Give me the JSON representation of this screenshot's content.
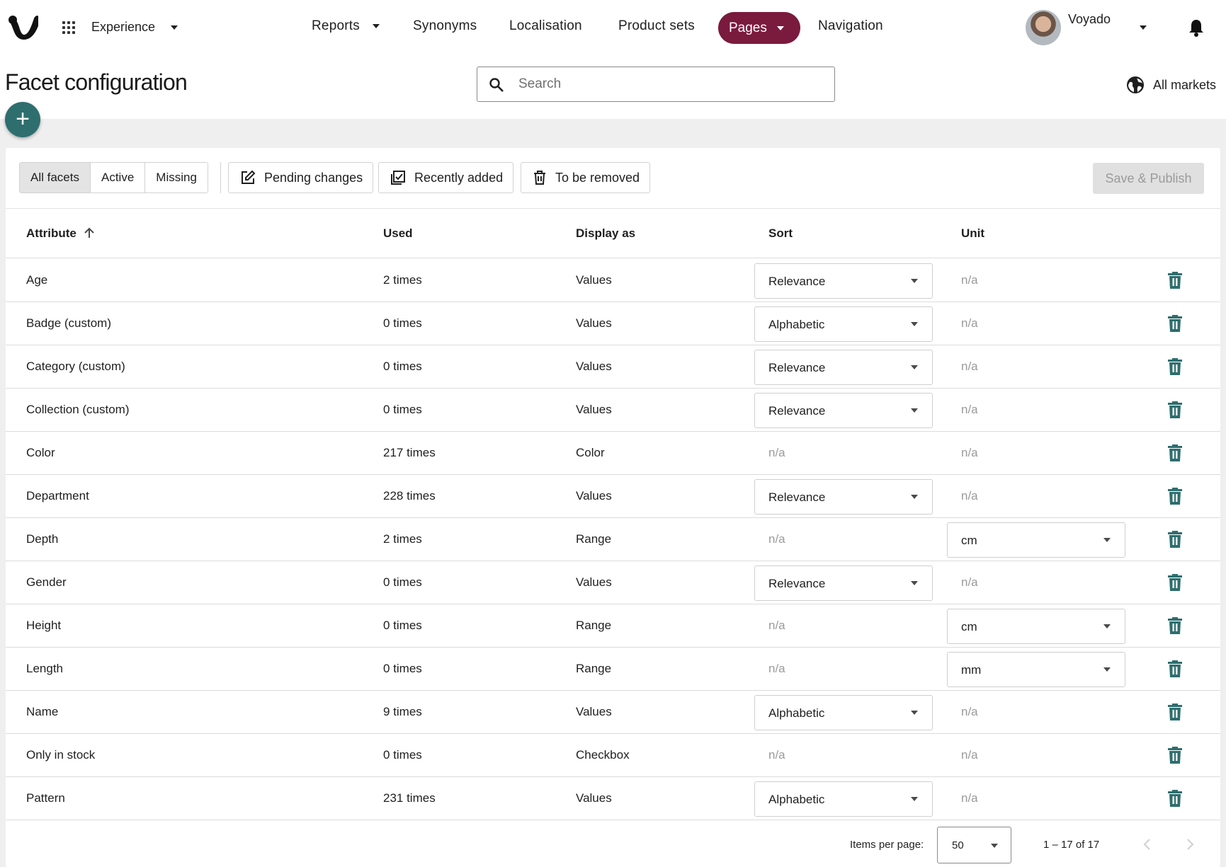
{
  "colors": {
    "accent_pill": "#7a1a3d",
    "fab": "#2e6e6e",
    "trash": "#2e6e6e"
  },
  "nav": {
    "app_switch_label": "Experience",
    "items": [
      {
        "label": "Reports",
        "has_caret": true
      },
      {
        "label": "Synonyms"
      },
      {
        "label": "Localisation"
      },
      {
        "label": "Product sets"
      },
      {
        "label": "Pages",
        "has_caret": true,
        "active": true
      },
      {
        "label": "Navigation"
      }
    ],
    "user_name": "Voyado"
  },
  "header": {
    "title": "Facet configuration",
    "search_placeholder": "Search",
    "markets_label": "All markets"
  },
  "toolbar": {
    "filters": [
      "All facets",
      "Active",
      "Missing"
    ],
    "active_filter": "All facets",
    "pending_changes": "Pending changes",
    "recently_added": "Recently added",
    "to_be_removed": "To be removed",
    "save_publish": "Save & Publish"
  },
  "table": {
    "headers": {
      "attribute": "Attribute",
      "used": "Used",
      "display_as": "Display as",
      "sort": "Sort",
      "unit": "Unit"
    },
    "sorted_by": "Attribute",
    "sort_direction": "ascending",
    "rows": [
      {
        "attribute": "Age",
        "used": "2 times",
        "display_as": "Values",
        "sort": "Relevance",
        "unit": "n/a"
      },
      {
        "attribute": "Badge (custom)",
        "used": "0 times",
        "display_as": "Values",
        "sort": "Alphabetic",
        "unit": "n/a"
      },
      {
        "attribute": "Category (custom)",
        "used": "0 times",
        "display_as": "Values",
        "sort": "Relevance",
        "unit": "n/a"
      },
      {
        "attribute": "Collection (custom)",
        "used": "0 times",
        "display_as": "Values",
        "sort": "Relevance",
        "unit": "n/a"
      },
      {
        "attribute": "Color",
        "used": "217 times",
        "display_as": "Color",
        "sort": "n/a",
        "unit": "n/a"
      },
      {
        "attribute": "Department",
        "used": "228 times",
        "display_as": "Values",
        "sort": "Relevance",
        "unit": "n/a"
      },
      {
        "attribute": "Depth",
        "used": "2 times",
        "display_as": "Range",
        "sort": "n/a",
        "unit": "cm"
      },
      {
        "attribute": "Gender",
        "used": "0 times",
        "display_as": "Values",
        "sort": "Relevance",
        "unit": "n/a"
      },
      {
        "attribute": "Height",
        "used": "0 times",
        "display_as": "Range",
        "sort": "n/a",
        "unit": "cm"
      },
      {
        "attribute": "Length",
        "used": "0 times",
        "display_as": "Range",
        "sort": "n/a",
        "unit": "mm"
      },
      {
        "attribute": "Name",
        "used": "9 times",
        "display_as": "Values",
        "sort": "Alphabetic",
        "unit": "n/a"
      },
      {
        "attribute": "Only in stock",
        "used": "0 times",
        "display_as": "Checkbox",
        "sort": "n/a",
        "unit": "n/a"
      },
      {
        "attribute": "Pattern",
        "used": "231 times",
        "display_as": "Values",
        "sort": "Alphabetic",
        "unit": "n/a"
      }
    ]
  },
  "pagination": {
    "items_per_page_label": "Items per page:",
    "items_per_page": "50",
    "range": "1 – 17 of 17"
  }
}
